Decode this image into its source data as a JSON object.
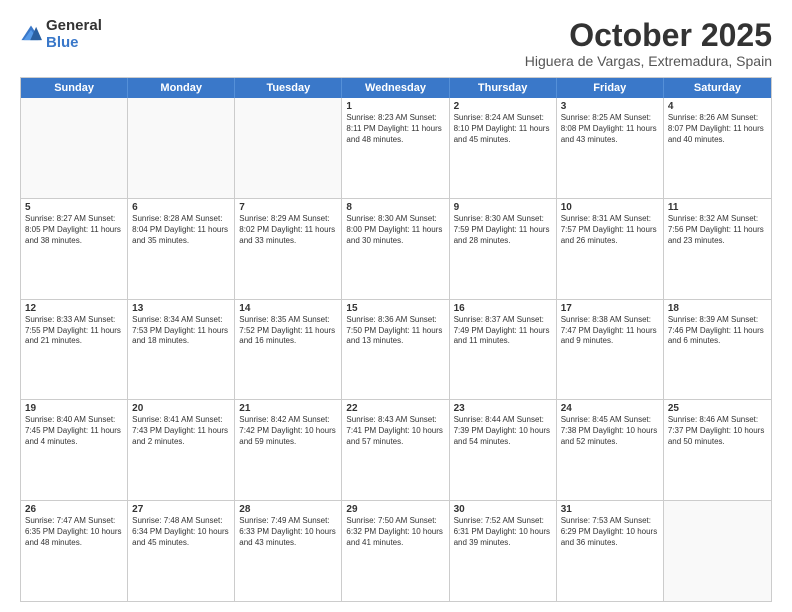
{
  "logo": {
    "general": "General",
    "blue": "Blue"
  },
  "header": {
    "month": "October 2025",
    "location": "Higuera de Vargas, Extremadura, Spain"
  },
  "weekdays": [
    "Sunday",
    "Monday",
    "Tuesday",
    "Wednesday",
    "Thursday",
    "Friday",
    "Saturday"
  ],
  "rows": [
    [
      {
        "day": "",
        "text": "",
        "empty": true
      },
      {
        "day": "",
        "text": "",
        "empty": true
      },
      {
        "day": "",
        "text": "",
        "empty": true
      },
      {
        "day": "1",
        "text": "Sunrise: 8:23 AM\nSunset: 8:11 PM\nDaylight: 11 hours and 48 minutes."
      },
      {
        "day": "2",
        "text": "Sunrise: 8:24 AM\nSunset: 8:10 PM\nDaylight: 11 hours and 45 minutes."
      },
      {
        "day": "3",
        "text": "Sunrise: 8:25 AM\nSunset: 8:08 PM\nDaylight: 11 hours and 43 minutes."
      },
      {
        "day": "4",
        "text": "Sunrise: 8:26 AM\nSunset: 8:07 PM\nDaylight: 11 hours and 40 minutes."
      }
    ],
    [
      {
        "day": "5",
        "text": "Sunrise: 8:27 AM\nSunset: 8:05 PM\nDaylight: 11 hours and 38 minutes."
      },
      {
        "day": "6",
        "text": "Sunrise: 8:28 AM\nSunset: 8:04 PM\nDaylight: 11 hours and 35 minutes."
      },
      {
        "day": "7",
        "text": "Sunrise: 8:29 AM\nSunset: 8:02 PM\nDaylight: 11 hours and 33 minutes."
      },
      {
        "day": "8",
        "text": "Sunrise: 8:30 AM\nSunset: 8:00 PM\nDaylight: 11 hours and 30 minutes."
      },
      {
        "day": "9",
        "text": "Sunrise: 8:30 AM\nSunset: 7:59 PM\nDaylight: 11 hours and 28 minutes."
      },
      {
        "day": "10",
        "text": "Sunrise: 8:31 AM\nSunset: 7:57 PM\nDaylight: 11 hours and 26 minutes."
      },
      {
        "day": "11",
        "text": "Sunrise: 8:32 AM\nSunset: 7:56 PM\nDaylight: 11 hours and 23 minutes."
      }
    ],
    [
      {
        "day": "12",
        "text": "Sunrise: 8:33 AM\nSunset: 7:55 PM\nDaylight: 11 hours and 21 minutes."
      },
      {
        "day": "13",
        "text": "Sunrise: 8:34 AM\nSunset: 7:53 PM\nDaylight: 11 hours and 18 minutes."
      },
      {
        "day": "14",
        "text": "Sunrise: 8:35 AM\nSunset: 7:52 PM\nDaylight: 11 hours and 16 minutes."
      },
      {
        "day": "15",
        "text": "Sunrise: 8:36 AM\nSunset: 7:50 PM\nDaylight: 11 hours and 13 minutes."
      },
      {
        "day": "16",
        "text": "Sunrise: 8:37 AM\nSunset: 7:49 PM\nDaylight: 11 hours and 11 minutes."
      },
      {
        "day": "17",
        "text": "Sunrise: 8:38 AM\nSunset: 7:47 PM\nDaylight: 11 hours and 9 minutes."
      },
      {
        "day": "18",
        "text": "Sunrise: 8:39 AM\nSunset: 7:46 PM\nDaylight: 11 hours and 6 minutes."
      }
    ],
    [
      {
        "day": "19",
        "text": "Sunrise: 8:40 AM\nSunset: 7:45 PM\nDaylight: 11 hours and 4 minutes."
      },
      {
        "day": "20",
        "text": "Sunrise: 8:41 AM\nSunset: 7:43 PM\nDaylight: 11 hours and 2 minutes."
      },
      {
        "day": "21",
        "text": "Sunrise: 8:42 AM\nSunset: 7:42 PM\nDaylight: 10 hours and 59 minutes."
      },
      {
        "day": "22",
        "text": "Sunrise: 8:43 AM\nSunset: 7:41 PM\nDaylight: 10 hours and 57 minutes."
      },
      {
        "day": "23",
        "text": "Sunrise: 8:44 AM\nSunset: 7:39 PM\nDaylight: 10 hours and 54 minutes."
      },
      {
        "day": "24",
        "text": "Sunrise: 8:45 AM\nSunset: 7:38 PM\nDaylight: 10 hours and 52 minutes."
      },
      {
        "day": "25",
        "text": "Sunrise: 8:46 AM\nSunset: 7:37 PM\nDaylight: 10 hours and 50 minutes."
      }
    ],
    [
      {
        "day": "26",
        "text": "Sunrise: 7:47 AM\nSunset: 6:35 PM\nDaylight: 10 hours and 48 minutes."
      },
      {
        "day": "27",
        "text": "Sunrise: 7:48 AM\nSunset: 6:34 PM\nDaylight: 10 hours and 45 minutes."
      },
      {
        "day": "28",
        "text": "Sunrise: 7:49 AM\nSunset: 6:33 PM\nDaylight: 10 hours and 43 minutes."
      },
      {
        "day": "29",
        "text": "Sunrise: 7:50 AM\nSunset: 6:32 PM\nDaylight: 10 hours and 41 minutes."
      },
      {
        "day": "30",
        "text": "Sunrise: 7:52 AM\nSunset: 6:31 PM\nDaylight: 10 hours and 39 minutes."
      },
      {
        "day": "31",
        "text": "Sunrise: 7:53 AM\nSunset: 6:29 PM\nDaylight: 10 hours and 36 minutes."
      },
      {
        "day": "",
        "text": "",
        "empty": true
      }
    ]
  ]
}
